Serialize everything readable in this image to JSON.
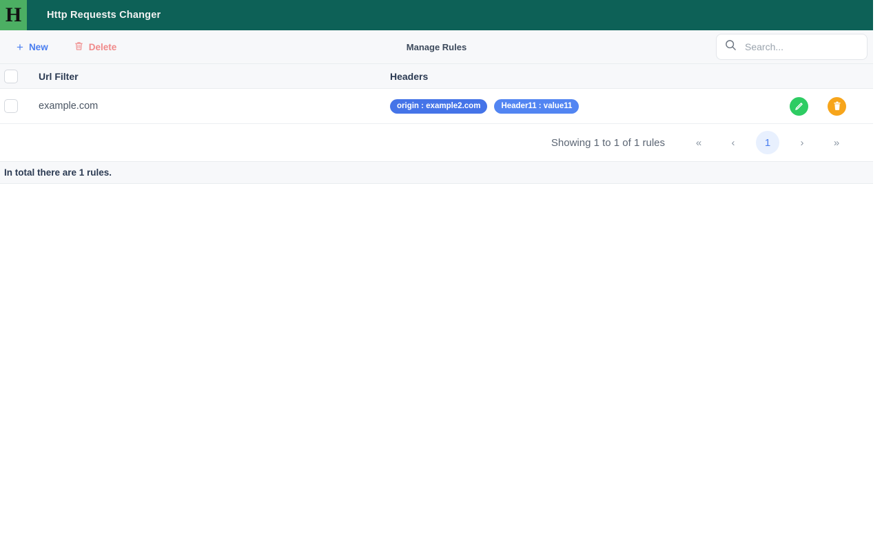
{
  "header": {
    "logo_letter": "H",
    "title": "Http Requests Changer",
    "logo_bg": "#4caf63",
    "bar_bg": "#0d6157"
  },
  "toolbar": {
    "new_label": "New",
    "new_icon": "plus-icon",
    "new_color": "#4a7ef0",
    "delete_label": "Delete",
    "delete_icon": "trash-icon",
    "delete_color": "#f08a8a",
    "page_title": "Manage Rules",
    "search": {
      "icon": "search-icon",
      "value": "",
      "placeholder": "Search..."
    }
  },
  "table": {
    "columns": [
      "Url Filter",
      "Headers"
    ],
    "rows": [
      {
        "url_filter": "example.com",
        "selected": false,
        "headers": [
          {
            "label": "origin : example2.com",
            "color": "#4574e8"
          },
          {
            "label": "Header11 : value11",
            "color": "#5285f2"
          }
        ],
        "actions": [
          {
            "name": "edit-rule-button",
            "icon": "pencil-icon",
            "color": "#2ecc63"
          },
          {
            "name": "delete-rule-button",
            "icon": "trash-icon",
            "color": "#f7a51b"
          }
        ]
      }
    ]
  },
  "pagination": {
    "showing_text": "Showing 1 to 1 of 1 rules",
    "first_label": "«",
    "prev_label": "‹",
    "pages": [
      "1"
    ],
    "current_page": "1",
    "next_label": "›",
    "last_label": "»",
    "active_bg": "#e8f0fe",
    "active_color": "#4a7ef0"
  },
  "footer": {
    "total_text": "In total there are 1 rules."
  }
}
